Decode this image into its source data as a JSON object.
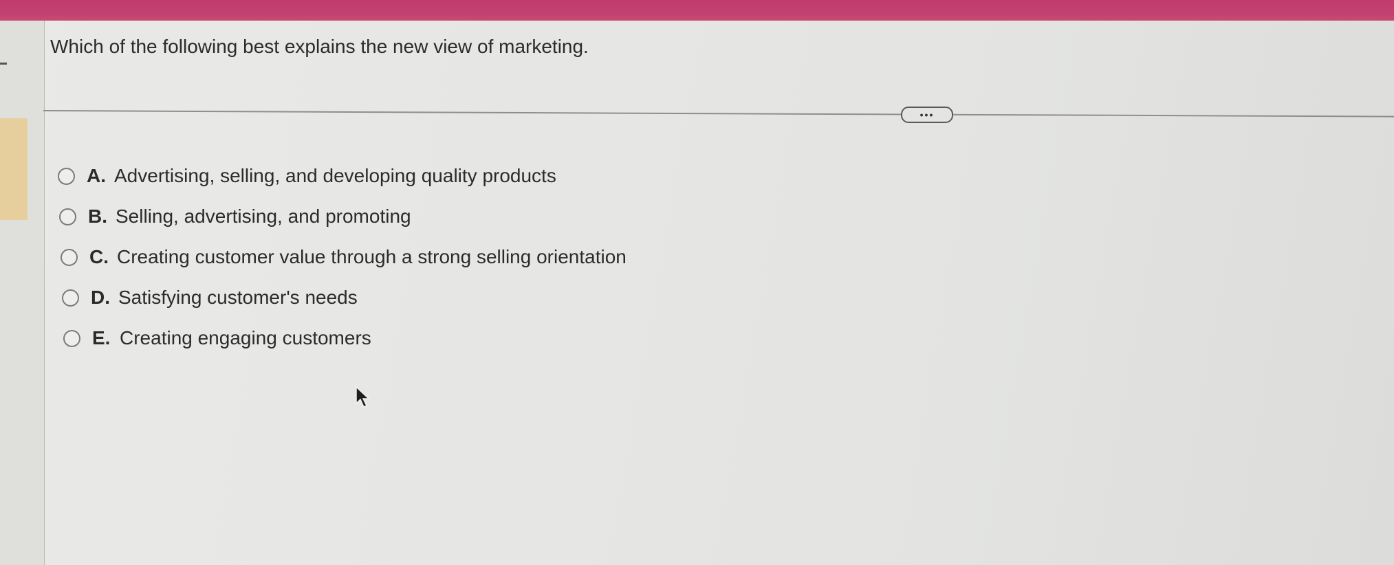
{
  "question": {
    "text": "Which of the following best explains the new view of marketing."
  },
  "more_button": {
    "label": "•••"
  },
  "options": [
    {
      "letter": "A.",
      "text": "Advertising, selling, and developing quality products",
      "selected": false
    },
    {
      "letter": "B.",
      "text": "Selling, advertising, and promoting",
      "selected": false
    },
    {
      "letter": "C.",
      "text": "Creating customer value through a strong selling orientation",
      "selected": false
    },
    {
      "letter": "D.",
      "text": "Satisfying customer's needs",
      "selected": false
    },
    {
      "letter": "E.",
      "text": "Creating engaging customers",
      "selected": false
    }
  ],
  "colors": {
    "header_bar": "#c2426f",
    "left_tab": "#e6cf9d",
    "background": "#e6e6e4"
  }
}
